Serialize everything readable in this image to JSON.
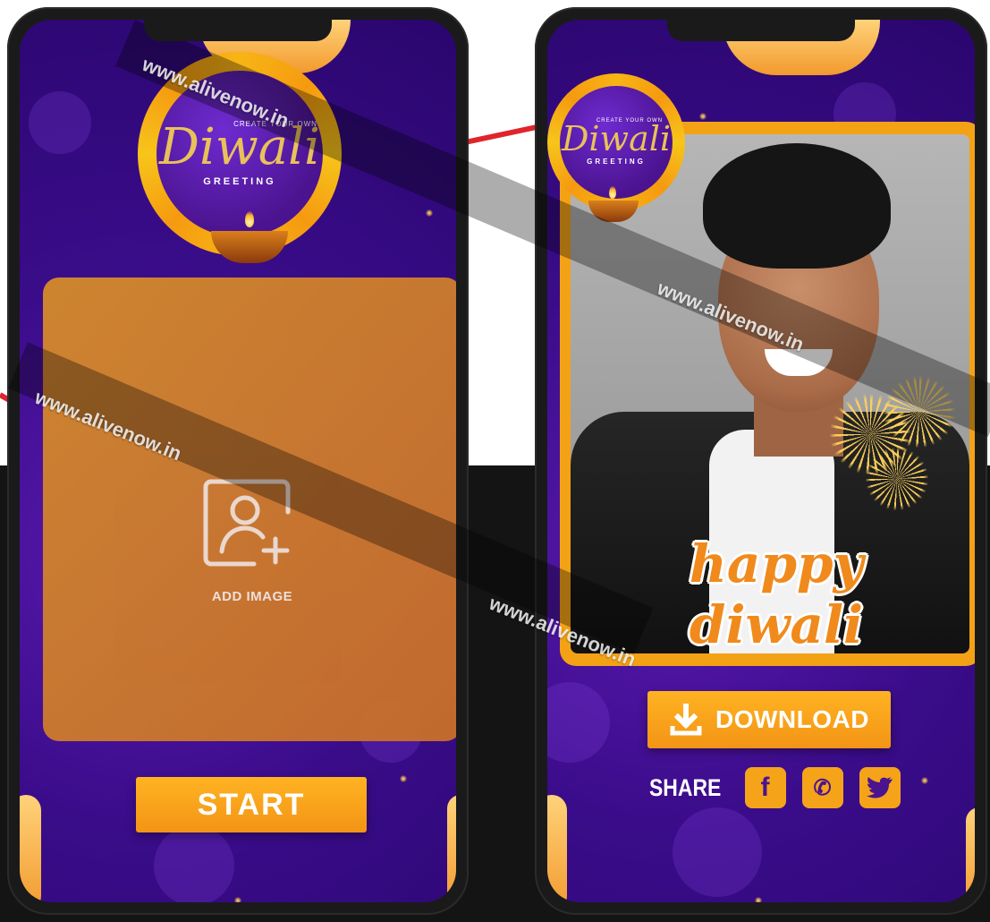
{
  "phone_left": {
    "badge": {
      "small_text": "CREATE YOUR OWN",
      "title": "Diwali",
      "subtitle": "GREETING"
    },
    "upload": {
      "label": "ADD IMAGE",
      "icon": "add-user-photo-icon"
    },
    "start_label": "START"
  },
  "phone_right": {
    "badge": {
      "small_text": "CREATE YOUR OWN",
      "title": "Diwali",
      "subtitle": "GREETING"
    },
    "greeting_text": "happy diwali",
    "download_label": "DOWNLOAD",
    "share_label": "SHARE",
    "social": [
      {
        "name": "facebook-icon",
        "glyph": "f"
      },
      {
        "name": "whatsapp-icon",
        "glyph": "✆"
      },
      {
        "name": "twitter-icon",
        "glyph": "🐦"
      }
    ]
  },
  "watermark": "www.alivenow.in",
  "colors": {
    "purple": "#3a0c8a",
    "accent_orange": "#f5a41a",
    "accent_red": "#e0242c"
  }
}
